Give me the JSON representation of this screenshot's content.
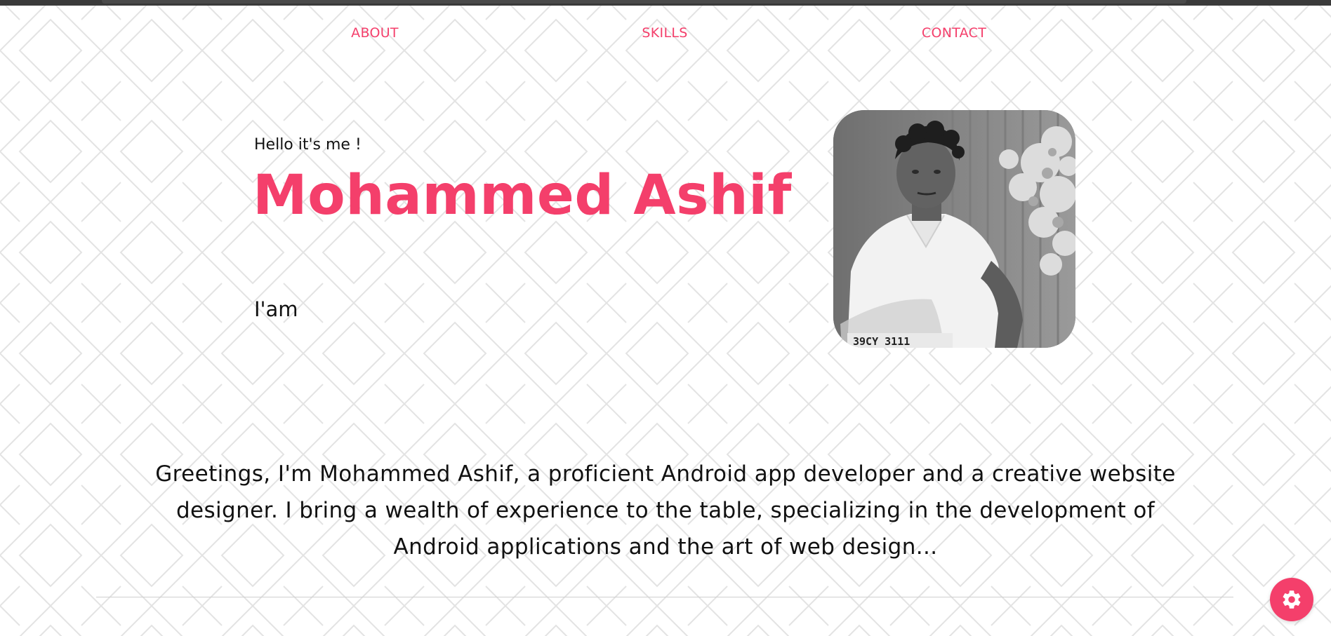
{
  "colors": {
    "accent": "#f43f6b",
    "pattern_line": "#e3e3e3",
    "text": "#111111"
  },
  "nav": {
    "items": [
      {
        "label": "ABOUT"
      },
      {
        "label": "SKILLS"
      },
      {
        "label": "CONTACT"
      }
    ]
  },
  "hero": {
    "greeting": "Hello it's me !",
    "name": "Mohammed Ashif",
    "iam": "I'am",
    "photo_icon": "profile-photo",
    "plate_text": "39CY 3111"
  },
  "bio": {
    "text": "Greetings, I'm Mohammed Ashif, a proficient Android app developer and a creative website designer. I bring a wealth of experience to the table, specializing in the development of Android applications and the art of web design..."
  },
  "settings": {
    "icon": "gear-icon"
  }
}
